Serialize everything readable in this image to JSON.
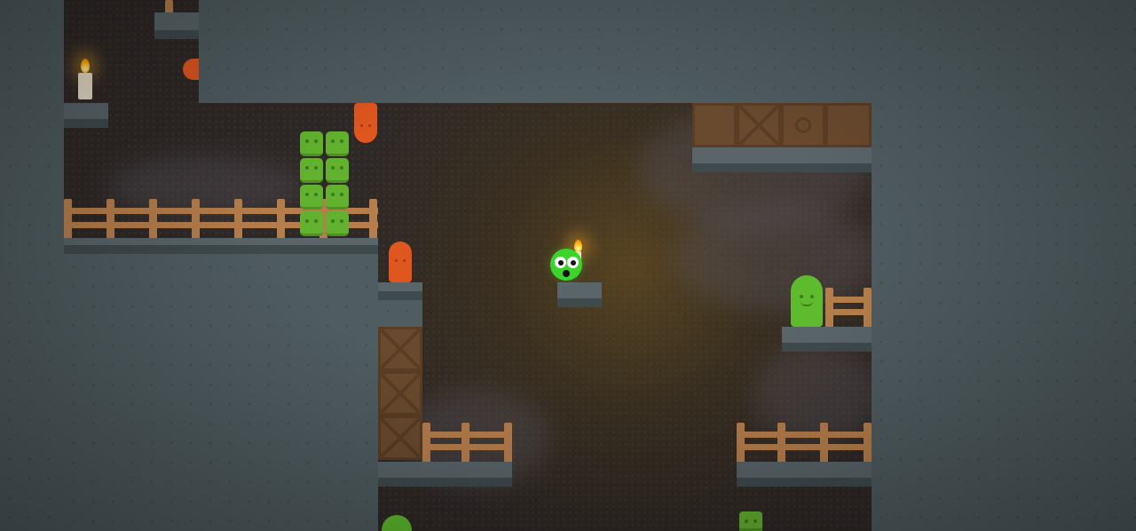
{
  "scene": {
    "name": "cave-level",
    "colors": {
      "stone": "#4f5c60",
      "cave": "#2e2826",
      "player": "#3bd42c",
      "orange_slug": "#e0561f",
      "green_slug": "#5fbb2e",
      "fence": "#b67e4c",
      "crate": "#6a4a2e"
    }
  },
  "player": {
    "icon": "green-blob-player",
    "holding": "candle"
  },
  "entities": {
    "green_block_columns": 2,
    "green_blocks_per_column": 4
  }
}
